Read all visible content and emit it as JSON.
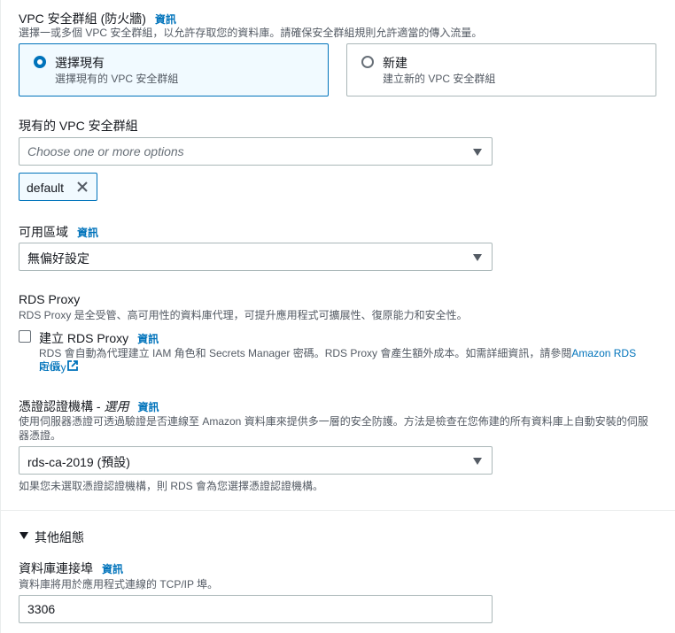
{
  "vpc_group": {
    "title": "VPC 安全群組 (防火牆)",
    "info": "資訊",
    "description": "選擇一或多個 VPC 安全群組，以允許存取您的資料庫。請確保安全群組規則允許適當的傳入流量。",
    "options": [
      {
        "title": "選擇現有",
        "desc": "選擇現有的 VPC 安全群組",
        "selected": true
      },
      {
        "title": "新建",
        "desc": "建立新的 VPC 安全群組",
        "selected": false
      }
    ]
  },
  "existing_sg": {
    "label": "現有的 VPC 安全群組",
    "placeholder": "Choose one or more options",
    "token": "default"
  },
  "az": {
    "label": "可用區域",
    "info": "資訊",
    "value": "無偏好設定"
  },
  "rds_proxy": {
    "title": "RDS Proxy",
    "description": "RDS Proxy 是全受管、高可用性的資料庫代理，可提升應用程式可擴展性、復原能力和安全性。",
    "checkbox_label": "建立 RDS Proxy",
    "info": "資訊",
    "note_part1": "RDS 會自動為代理建立 IAM 角色和 Secrets Manager 密碼。RDS Proxy 會產生額外成本。如需詳細資訊，請參閱",
    "link_line1": "Amazon RDS Proxy",
    "link_line2": "定價",
    "checked": false
  },
  "cert": {
    "label_main": "憑證認證機構 - ",
    "label_optional": "選用",
    "info": "資訊",
    "description_line1": "使用伺服器憑證可透過驗證是否連線至 Amazon 資料庫來提供多一層的安全防護。方法是檢查在您佈建的所有資料庫上自動安裝的伺服",
    "description_line2": "器憑證。",
    "value": "rds-ca-2019 (預設)",
    "hint": "如果您未選取憑證認證機構，則 RDS 會為您選擇憑證認證機構。"
  },
  "additional": {
    "toggle": "其他組態"
  },
  "port": {
    "label": "資料庫連接埠",
    "info": "資訊",
    "description": "資料庫將用於應用程式連線的 TCP/IP 埠。",
    "value": "3306"
  },
  "colors": {
    "accent": "#0073bb",
    "text": "#16191f",
    "secondary": "#545b64",
    "border": "#aab7b8"
  }
}
